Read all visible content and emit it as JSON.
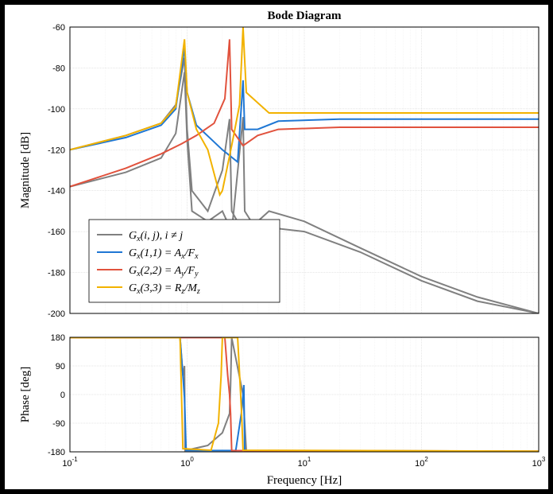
{
  "chart_data": {
    "type": "line",
    "title": "Bode Diagram",
    "xlabel": "Frequency [Hz]",
    "panels": [
      {
        "ylabel": "Magnitude [dB]",
        "ylim": [
          -200,
          -60
        ],
        "yticks": [
          -200,
          -180,
          -160,
          -140,
          -120,
          -100,
          -80,
          -60
        ]
      },
      {
        "ylabel": "Phase [deg]",
        "ylim": [
          -180,
          180
        ],
        "yticks": [
          -180,
          -90,
          0,
          90,
          180
        ]
      }
    ],
    "xlim": [
      0.1,
      1000
    ],
    "xticks": [
      0.1,
      1,
      10,
      100,
      1000
    ],
    "xtick_labels": [
      "10^{-1}",
      "10^{0}",
      "10^{1}",
      "10^{2}",
      "10^{3}"
    ],
    "legend": [
      {
        "label": "G_x(i,j),  i \\ne j",
        "color": "#808080"
      },
      {
        "label": "G_x(1,1) = A_x/F_x",
        "color": "#1f77d4"
      },
      {
        "label": "G_x(2,2) = A_y/F_y",
        "color": "#e1523d"
      },
      {
        "label": "G_x(3,3) = R_z/M_z",
        "color": "#f2b200"
      }
    ],
    "series_mag": {
      "offdiag_shapes": [
        [
          [
            0.1,
            -120
          ],
          [
            0.3,
            -113
          ],
          [
            0.6,
            -107
          ],
          [
            0.8,
            -98
          ],
          [
            0.95,
            -75
          ],
          [
            1.0,
            -110
          ],
          [
            1.1,
            -140
          ],
          [
            1.5,
            -150
          ],
          [
            2,
            -130
          ],
          [
            2.3,
            -105
          ],
          [
            2.4,
            -150
          ],
          [
            3,
            -160
          ],
          [
            4,
            -155
          ],
          [
            5,
            -150
          ],
          [
            10,
            -155
          ],
          [
            30,
            -168
          ],
          [
            100,
            -182
          ],
          [
            300,
            -192
          ],
          [
            1000,
            -205
          ]
        ],
        [
          [
            0.1,
            -138
          ],
          [
            0.3,
            -131
          ],
          [
            0.6,
            -124
          ],
          [
            0.8,
            -112
          ],
          [
            0.95,
            -82
          ],
          [
            1.0,
            -115
          ],
          [
            1.1,
            -150
          ],
          [
            1.5,
            -155
          ],
          [
            2,
            -150
          ],
          [
            2.4,
            -160
          ],
          [
            3,
            -104
          ],
          [
            3.1,
            -150
          ],
          [
            4,
            -160
          ],
          [
            5,
            -158
          ],
          [
            10,
            -160
          ],
          [
            30,
            -170
          ],
          [
            100,
            -184
          ],
          [
            300,
            -194
          ],
          [
            1000,
            -206
          ]
        ]
      ],
      "g11": [
        [
          0.1,
          -120
        ],
        [
          0.3,
          -114
        ],
        [
          0.6,
          -108
        ],
        [
          0.8,
          -100
        ],
        [
          0.95,
          -70
        ],
        [
          1.0,
          -92
        ],
        [
          1.2,
          -108
        ],
        [
          2,
          -120
        ],
        [
          2.7,
          -126
        ],
        [
          3.0,
          -86
        ],
        [
          3.1,
          -110
        ],
        [
          4,
          -110
        ],
        [
          6,
          -106
        ],
        [
          20,
          -105
        ],
        [
          100,
          -105
        ],
        [
          1000,
          -105
        ]
      ],
      "g22": [
        [
          0.1,
          -138
        ],
        [
          0.3,
          -129
        ],
        [
          0.6,
          -122
        ],
        [
          0.9,
          -117
        ],
        [
          1.2,
          -113
        ],
        [
          1.7,
          -107
        ],
        [
          2.1,
          -95
        ],
        [
          2.3,
          -66
        ],
        [
          2.4,
          -110
        ],
        [
          3,
          -118
        ],
        [
          4,
          -113
        ],
        [
          6,
          -110
        ],
        [
          20,
          -109
        ],
        [
          100,
          -109
        ],
        [
          1000,
          -109
        ]
      ],
      "g33": [
        [
          0.1,
          -120
        ],
        [
          0.3,
          -113
        ],
        [
          0.6,
          -107
        ],
        [
          0.8,
          -99
        ],
        [
          0.95,
          -66
        ],
        [
          1.0,
          -92
        ],
        [
          1.2,
          -110
        ],
        [
          1.5,
          -120
        ],
        [
          1.9,
          -142
        ],
        [
          2.0,
          -140
        ],
        [
          2.4,
          -118
        ],
        [
          2.8,
          -98
        ],
        [
          3.0,
          -60
        ],
        [
          3.2,
          -92
        ],
        [
          5,
          -102
        ],
        [
          10,
          -102
        ],
        [
          100,
          -102
        ],
        [
          1000,
          -102
        ]
      ]
    },
    "series_phase": {
      "offdiag": [
        [
          0.1,
          179
        ],
        [
          0.87,
          179
        ],
        [
          0.92,
          60
        ],
        [
          0.95,
          90
        ],
        [
          0.96,
          -176
        ],
        [
          1.5,
          -160
        ],
        [
          2,
          -120
        ],
        [
          2.3,
          -60
        ],
        [
          2.35,
          30
        ],
        [
          2.4,
          179
        ],
        [
          3,
          0
        ],
        [
          3.2,
          -178
        ],
        [
          1000,
          -179
        ]
      ],
      "g11": [
        [
          0.1,
          179
        ],
        [
          0.87,
          179
        ],
        [
          0.92,
          60
        ],
        [
          0.95,
          -10
        ],
        [
          0.98,
          -176
        ],
        [
          2.6,
          -176
        ],
        [
          2.9,
          -60
        ],
        [
          3.0,
          0
        ],
        [
          3.05,
          30
        ],
        [
          3.1,
          -176
        ],
        [
          1000,
          -178
        ]
      ],
      "g22": [
        [
          0.1,
          179
        ],
        [
          2.1,
          179
        ],
        [
          2.22,
          60
        ],
        [
          2.3,
          0
        ],
        [
          2.35,
          -60
        ],
        [
          2.4,
          -176
        ],
        [
          1000,
          -178
        ]
      ],
      "g33": [
        [
          0.1,
          179
        ],
        [
          0.87,
          179
        ],
        [
          0.92,
          -170
        ],
        [
          1.6,
          -175
        ],
        [
          1.85,
          -90
        ],
        [
          1.95,
          60
        ],
        [
          2.0,
          179
        ],
        [
          2.7,
          179
        ],
        [
          2.9,
          -40
        ],
        [
          3.0,
          -175
        ],
        [
          1000,
          -178
        ]
      ]
    }
  }
}
